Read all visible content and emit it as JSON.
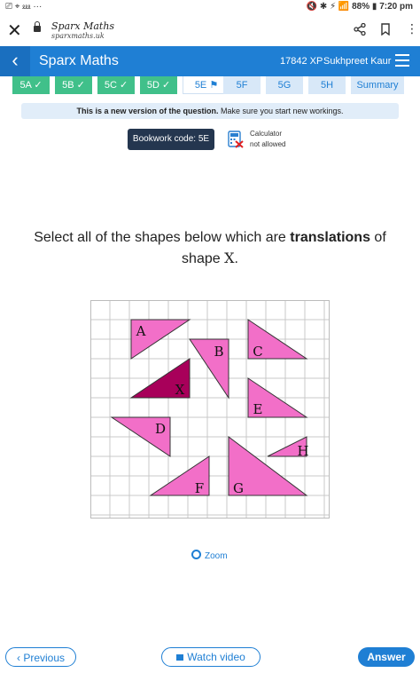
{
  "status": {
    "left": "⎚ ⌖ ⅏ ···",
    "right": "🔇 ✱ ⚡ 📶 88% ▮ 7:20 pm"
  },
  "browser": {
    "title": "Sparx Maths",
    "url": "sparxmaths.uk"
  },
  "header": {
    "title": "Sparx Maths",
    "xp": "17842 XP",
    "user": "Sukhpreet Kaur",
    "back": "‹"
  },
  "tabs": [
    {
      "label": "5A ✓",
      "state": "done"
    },
    {
      "label": "5B ✓",
      "state": "done"
    },
    {
      "label": "5C ✓",
      "state": "done"
    },
    {
      "label": "5D ✓",
      "state": "done"
    },
    {
      "label": "5E ⚑",
      "state": "current"
    },
    {
      "label": "5F",
      "state": "todo"
    },
    {
      "label": "5G",
      "state": "todo"
    },
    {
      "label": "5H",
      "state": "todo"
    },
    {
      "label": "Summary",
      "state": "todo"
    }
  ],
  "banner": {
    "bold": "This is a new version of the question.",
    "rest": " Make sure you start new workings."
  },
  "bookwork": "Bookwork code: 5E",
  "calculator": {
    "line1": "Calculator",
    "line2": "not allowed"
  },
  "question": {
    "line1a": "Select all of the shapes below which are ",
    "bold": "translations",
    "line1b": " of",
    "line2a": "shape ",
    "shape": "X",
    "line2b": "."
  },
  "shapes": [
    "A",
    "B",
    "C",
    "D",
    "E",
    "F",
    "G",
    "H",
    "X"
  ],
  "zoom": "Zoom",
  "buttons": {
    "previous": "‹ Previous",
    "video": "Watch video",
    "answer": "Answer"
  },
  "colors": {
    "accent": "#1f7fd4",
    "done": "#40c08a",
    "shape": "#f26fc8",
    "shape_x": "#a8005a"
  }
}
